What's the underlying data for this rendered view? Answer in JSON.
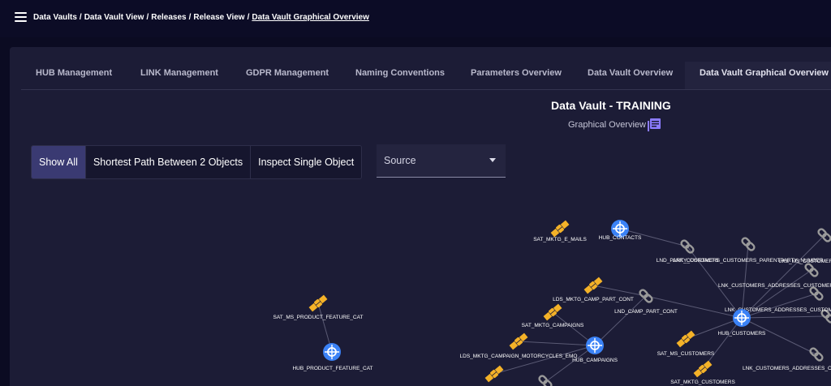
{
  "breadcrumb": {
    "items": [
      "Data Vaults",
      "Data Vault View",
      "Releases",
      "Release View"
    ],
    "current": "Data Vault Graphical Overview",
    "separator": "/"
  },
  "tabs": [
    {
      "label": "HUB Management"
    },
    {
      "label": "LINK Management"
    },
    {
      "label": "GDPR Management"
    },
    {
      "label": "Naming Conventions"
    },
    {
      "label": "Parameters Overview"
    },
    {
      "label": "Data Vault Overview"
    },
    {
      "label": "Data Vault Graphical Overview",
      "active": true
    }
  ],
  "header": {
    "title": "Data Vault - TRAINING",
    "subtitle": "Graphical Overview"
  },
  "modes": {
    "show_all": "Show All",
    "shortest_path": "Shortest Path Between 2 Objects",
    "inspect_single": "Inspect Single Object"
  },
  "source_select": {
    "value": "Source"
  },
  "graph": {
    "colors": {
      "hub": "#3b82f6",
      "satellite": "#f4b228",
      "link": "#9a9a9a",
      "edge": "#5a5a74"
    },
    "nodes": [
      {
        "id": "sat_ms_pf",
        "type": "satellite",
        "label": "SAT_MS_PRODUCT_FEATURE_CAT"
      },
      {
        "id": "hub_pf",
        "type": "hub",
        "label": "HUB_PRODUCT_FEATURE_CAT"
      },
      {
        "id": "sat_e_mails",
        "type": "satellite",
        "label": "SAT_MKTG_E_MAILS"
      },
      {
        "id": "hub_contacts",
        "type": "hub",
        "label": "HUB_CONTACTS"
      },
      {
        "id": "lds_camp_part",
        "type": "satellite",
        "label": "LDS_MKTG_CAMP_PART_CONT"
      },
      {
        "id": "lnd_camp_part",
        "type": "link",
        "label": "LND_CAMP_PART_CONT"
      },
      {
        "id": "sat_campaigns",
        "type": "satellite",
        "label": "SAT_MKTG_CAMPAIGNS"
      },
      {
        "id": "lds_motor",
        "type": "satellite",
        "label": "LDS_MKTG_CAMPAIGN_MOTORCYCLES_EMO"
      },
      {
        "id": "hub_campaigns",
        "type": "hub",
        "label": "HUB_CAMPAIGNS"
      },
      {
        "id": "lnd_party",
        "type": "link",
        "label": "LND_PARTY_CONTACTS"
      },
      {
        "id": "lnk_parent",
        "type": "link",
        "label": "LNK_CUSTOMERS_CUSTOMERS_PARENTPARTY_NUMBER"
      },
      {
        "id": "lks_ms",
        "type": "link",
        "label": "LKS_MS_CUSTOMER"
      },
      {
        "id": "lnk_addr1",
        "type": "link",
        "label": "LNK_CUSTOMERS_ADDRESSES_CUSTOMER"
      },
      {
        "id": "lnk_addr2",
        "type": "link",
        "label": "LNK_CUSTOMERS_ADDRESSES_CUSTOMER"
      },
      {
        "id": "hub_customers",
        "type": "hub",
        "label": "HUB_CUSTOMERS"
      },
      {
        "id": "sat_ms_cust",
        "type": "satellite",
        "label": "SAT_MS_CUSTOMERS"
      },
      {
        "id": "sat_mktg_cust",
        "type": "satellite",
        "label": "SAT_MKTG_CUSTOMERS"
      },
      {
        "id": "lnk_addr3",
        "type": "link",
        "label": "LNK_CUSTOMERS_ADDRESSES_CUSTOMER"
      },
      {
        "id": "sat_bottom",
        "type": "satellite",
        "label": ""
      },
      {
        "id": "lnk_bottom",
        "type": "link",
        "label": ""
      },
      {
        "id": "lnk_right",
        "type": "link",
        "label": ""
      }
    ],
    "edges": [
      [
        "sat_ms_pf",
        "hub_pf"
      ],
      [
        "hub_contacts",
        "lnd_party"
      ],
      [
        "lds_camp_part",
        "lnd_camp_part"
      ],
      [
        "lnd_camp_part",
        "hub_customers"
      ],
      [
        "lnd_camp_part",
        "hub_campaigns"
      ],
      [
        "sat_campaigns",
        "hub_campaigns"
      ],
      [
        "lds_motor",
        "hub_campaigns"
      ],
      [
        "lnd_party",
        "hub_customers"
      ],
      [
        "lnk_parent",
        "hub_customers"
      ],
      [
        "lks_ms",
        "hub_customers"
      ],
      [
        "lnk_addr1",
        "hub_customers"
      ],
      [
        "lnk_addr2",
        "hub_customers"
      ],
      [
        "hub_customers",
        "sat_ms_cust"
      ],
      [
        "hub_customers",
        "sat_mktg_cust"
      ],
      [
        "hub_customers",
        "lnk_addr3"
      ],
      [
        "hub_customers",
        "lnk_right"
      ],
      [
        "hub_campaigns",
        "lnk_bottom"
      ],
      [
        "sat_bottom",
        "hub_campaigns"
      ]
    ]
  }
}
